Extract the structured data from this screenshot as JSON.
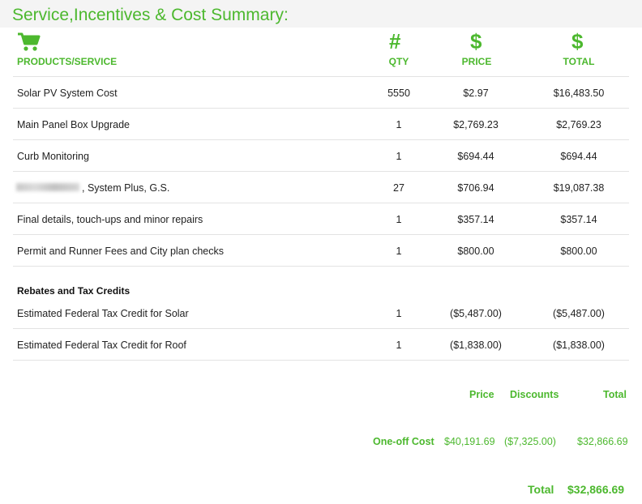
{
  "title": "Service,Incentives & Cost Summary:",
  "columns": {
    "product": "PRODUCTS/SERVICE",
    "qty": "QTY",
    "price": "PRICE",
    "total": "TOTAL"
  },
  "icons": {
    "product": "shopping-cart-icon",
    "qty": "hash-icon",
    "price": "dollar-icon",
    "total": "dollar-icon",
    "qty_glyph": "#",
    "dollar_glyph": "$"
  },
  "items": [
    {
      "name": "Solar PV System Cost",
      "qty": "5550",
      "price": "$2.97",
      "total": "$16,483.50"
    },
    {
      "name": "Main Panel Box Upgrade",
      "qty": "1",
      "price": "$2,769.23",
      "total": "$2,769.23"
    },
    {
      "name": "Curb Monitoring",
      "qty": "1",
      "price": "$694.44",
      "total": "$694.44"
    },
    {
      "name": ", System Plus, G.S.",
      "qty": "27",
      "price": "$706.94",
      "total": "$19,087.38"
    },
    {
      "name": "Final details, touch-ups and minor repairs",
      "qty": "1",
      "price": "$357.14",
      "total": "$357.14"
    },
    {
      "name": "Permit and Runner Fees and City plan checks",
      "qty": "1",
      "price": "$800.00",
      "total": "$800.00"
    }
  ],
  "rebates_title": "Rebates and Tax Credits",
  "rebates": [
    {
      "name": "Estimated Federal Tax Credit for Solar",
      "qty": "1",
      "price": "($5,487.00)",
      "total": "($5,487.00)"
    },
    {
      "name": "Estimated Federal Tax Credit for Roof",
      "qty": "1",
      "price": "($1,838.00)",
      "total": "($1,838.00)"
    }
  ],
  "summary": {
    "price_label": "Price",
    "discounts_label": "Discounts",
    "total_label": "Total",
    "oneoff_label": "One-off Cost",
    "oneoff_price": "$40,191.69",
    "oneoff_discounts": "($7,325.00)",
    "oneoff_total": "$32,866.69",
    "grand_label": "Total",
    "grand_value": "$32,866.69"
  },
  "colors": {
    "accent": "#4cb82e",
    "text": "#222222",
    "divider": "#e3e3e3"
  }
}
